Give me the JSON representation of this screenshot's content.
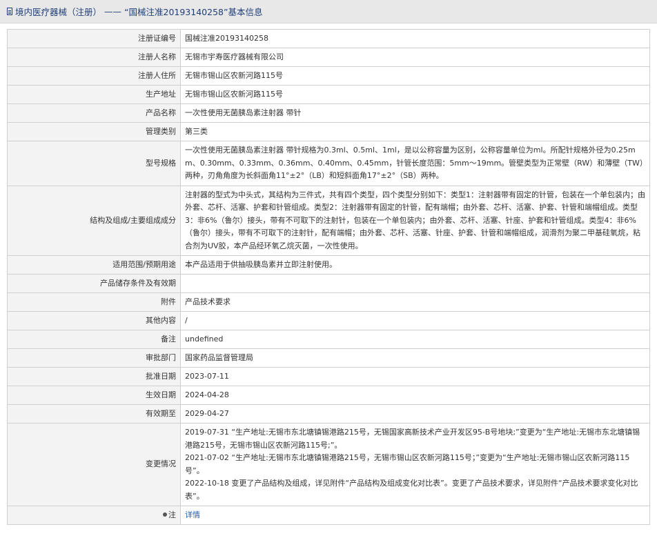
{
  "header": {
    "category": "境内医疗器械（注册）",
    "separator": "——",
    "title": "“国械注准20193140258”基本信息"
  },
  "rows": [
    {
      "key": "注册证编号",
      "value": "国械注准20193140258"
    },
    {
      "key": "注册人名称",
      "value": "无锡市宇寿医疗器械有限公司"
    },
    {
      "key": "注册人住所",
      "value": "无锡市锡山区农新河路115号"
    },
    {
      "key": "生产地址",
      "value": "无锡市锡山区农新河路115号"
    },
    {
      "key": "产品名称",
      "value": "一次性使用无菌胰岛素注射器 带针"
    },
    {
      "key": "管理类别",
      "value": "第三类"
    },
    {
      "key": "型号规格",
      "value": "一次性使用无菌胰岛素注射器 带针规格为0.3ml、0.5ml、1ml，是以公称容量为区别，公称容量单位为ml。所配针规格外径为0.25mm、0.30mm、0.33mm、0.36mm、0.40mm、0.45mm，针管长度范围：5mm～19mm。管壁类型为正常壁（RW）和薄壁（TW）两种，刃角角度为长斜面角11°±2°（LB）和短斜面角17°±2°（SB）两种。"
    },
    {
      "key": "结构及组成/主要组成成分",
      "value": "注射器的型式为中头式，其结构为三件式，共有四个类型，四个类型分别如下：类型1：注射器带有固定的针管，包装在一个单包装内；由外套、芯杆、活塞、护套和针管组成。类型2：注射器带有固定的针管，配有端帽；由外套、芯杆、活塞、护套、针管和端帽组成。类型3：非6%（鲁尔）接头，带有不可取下的注射针，包装在一个单包装内；由外套、芯杆、活塞、针座、护套和针管组成。类型4：非6%（鲁尔）接头，带有不可取下的注射针，配有端帽；由外套、芯杆、活塞、针座、护套、针管和端帽组成，润滑剂为聚二甲基硅氧烷，粘合剂为UV胶，本产品经环氧乙烷灭菌，一次性使用。"
    },
    {
      "key": "适用范围/预期用途",
      "value": "本产品适用于供抽吸胰岛素并立即注射使用。"
    },
    {
      "key": "产品储存条件及有效期",
      "value": ""
    },
    {
      "key": "附件",
      "value": "产品技术要求"
    },
    {
      "key": "其他内容",
      "value": "/"
    },
    {
      "key": "备注",
      "value": "undefined"
    },
    {
      "key": "审批部门",
      "value": "国家药品监督管理局"
    },
    {
      "key": "批准日期",
      "value": "2023-07-11"
    },
    {
      "key": "生效日期",
      "value": "2024-04-28"
    },
    {
      "key": "有效期至",
      "value": "2029-04-27"
    }
  ],
  "changes": {
    "key": "变更情况",
    "items": [
      "2019-07-31 “生产地址:无锡市东北塘镇锡港路215号，无锡国家高新技术产业开发区95-B号地块;”变更为“生产地址:无锡市东北塘镇锡港路215号，无锡市锡山区农新河路115号;”。",
      "2021-07-02 “生产地址:无锡市东北塘镇锡港路215号，无锡市锡山区农新河路115号；”变更为“生产地址:无锡市锡山区农新河路115号”。",
      "2022-10-18 变更了产品结构及组成，详见附件“产品结构及组成变化对比表”。变更了产品技术要求，详见附件“产品技术要求变化对比表”。"
    ]
  },
  "note": {
    "key": "注",
    "link": "详情",
    "icon": "pin-icon"
  }
}
